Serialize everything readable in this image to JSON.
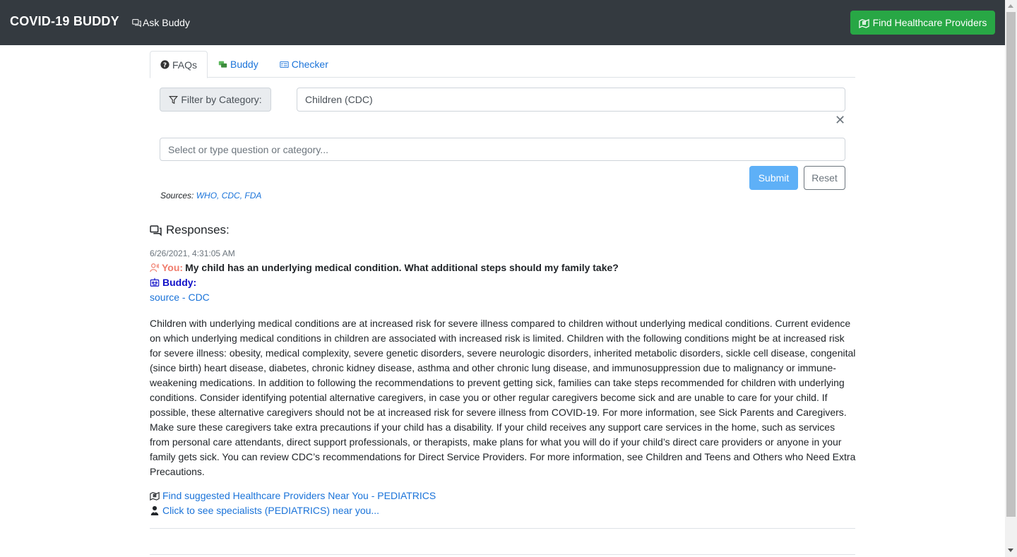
{
  "navbar": {
    "brand": "COVID-19 BUDDY",
    "ask_link": "Ask Buddy",
    "find_button": "Find Healthcare Providers"
  },
  "tabs": [
    {
      "label": "FAQs",
      "active": true,
      "icon": "question-circle-icon"
    },
    {
      "label": "Buddy",
      "active": false,
      "icon": "chat-bubbles-icon"
    },
    {
      "label": "Checker",
      "active": false,
      "icon": "checklist-card-icon"
    }
  ],
  "filter": {
    "label": "Filter by Category:",
    "selected_category": "Children (CDC)",
    "clear_symbol": "✕"
  },
  "question": {
    "placeholder": "Select or type question or category..."
  },
  "buttons": {
    "submit": "Submit",
    "reset": "Reset"
  },
  "sources": {
    "label": "Sources: ",
    "links": "WHO, CDC, FDA"
  },
  "responses": {
    "title": "Responses:",
    "timestamp": "6/26/2021, 4:31:05 AM",
    "you_label": "You:",
    "you_question": "My child has an underlying medical condition. What additional steps should my family take?",
    "buddy_label": "Buddy:",
    "source_link": "source - CDC",
    "answer": "Children with underlying medical conditions are at increased risk for severe illness compared to children without underlying medical conditions. Current evidence on which underlying medical conditions in children are associated with increased risk is limited. Children with the following conditions might be at increased risk for severe illness: obesity, medical complexity, severe genetic disorders, severe neurologic disorders, inherited metabolic disorders, sickle cell disease, congenital (since birth) heart disease, diabetes, chronic kidney disease, asthma and other chronic lung disease, and immunosuppression due to malignancy or immune-weakening medications. In addition to following the recommendations to prevent getting sick, families can take steps recommended for children with underlying conditions. Consider identifying potential alternative caregivers, in case you or other regular caregivers become sick and are unable to care for your child. If possible, these alternative caregivers should not be at increased risk for severe illness from COVID-19. For more information, see Sick Parents and Caregivers. Make sure these caregivers take extra precautions if your child has a disability. If your child receives any support care services in the home, such as services from personal care attendants, direct support professionals, or therapists, make plans for what you will do if your child’s direct care providers or anyone in your family gets sick. You can review CDC’s recommendations for Direct Service Providers. For more information, see Children and Teens and Others who Need Extra Precautions.",
    "providers_link": "Find suggested Healthcare Providers Near You - PEDIATRICS",
    "specialists_link": "Click to see specialists (PEDIATRICS) near you..."
  },
  "colors": {
    "navbar_bg": "#343a40",
    "success": "#28a745",
    "link": "#1a73d9",
    "you_label": "#f07c6c",
    "buddy_label": "#1010c8",
    "submit_bg": "#5eb0f7"
  }
}
